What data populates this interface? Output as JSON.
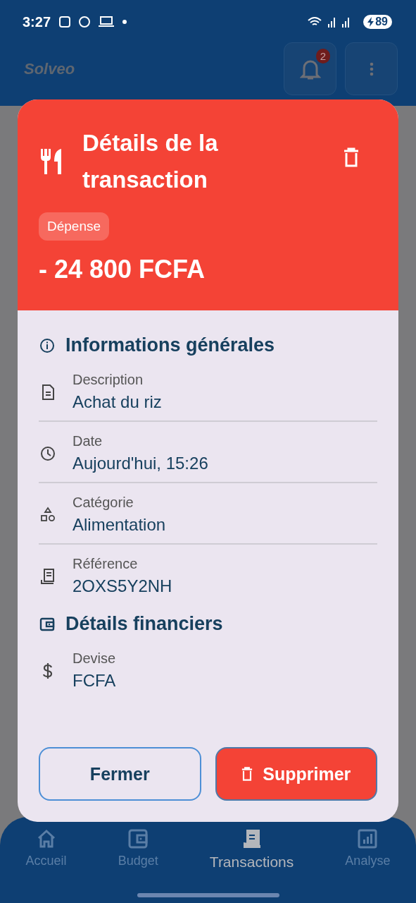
{
  "status_bar": {
    "time": "3:27",
    "battery": "89"
  },
  "header": {
    "logo": "Solveo",
    "notification_count": "2"
  },
  "dialog": {
    "title": "Détails de la transaction",
    "tag": "Dépense",
    "amount": "- 24 800 FCFA",
    "sections": [
      {
        "title": "Informations générales",
        "rows": [
          {
            "label": "Description",
            "value": "Achat du riz"
          },
          {
            "label": "Date",
            "value": "Aujourd'hui, 15:26"
          },
          {
            "label": "Catégorie",
            "value": "Alimentation"
          },
          {
            "label": "Référence",
            "value": "2OXS5Y2NH"
          }
        ]
      },
      {
        "title": "Détails financiers",
        "rows": [
          {
            "label": "Devise",
            "value": "FCFA"
          }
        ]
      }
    ],
    "buttons": [
      {
        "kind": "outline",
        "label": "Fermer"
      },
      {
        "kind": "danger",
        "label": "Supprimer"
      }
    ]
  },
  "bottom_nav": [
    {
      "label": "Accueil",
      "selected": false
    },
    {
      "label": "Budget",
      "selected": false
    },
    {
      "label": "Transactions",
      "selected": true
    },
    {
      "label": "Analyse",
      "selected": false
    }
  ]
}
